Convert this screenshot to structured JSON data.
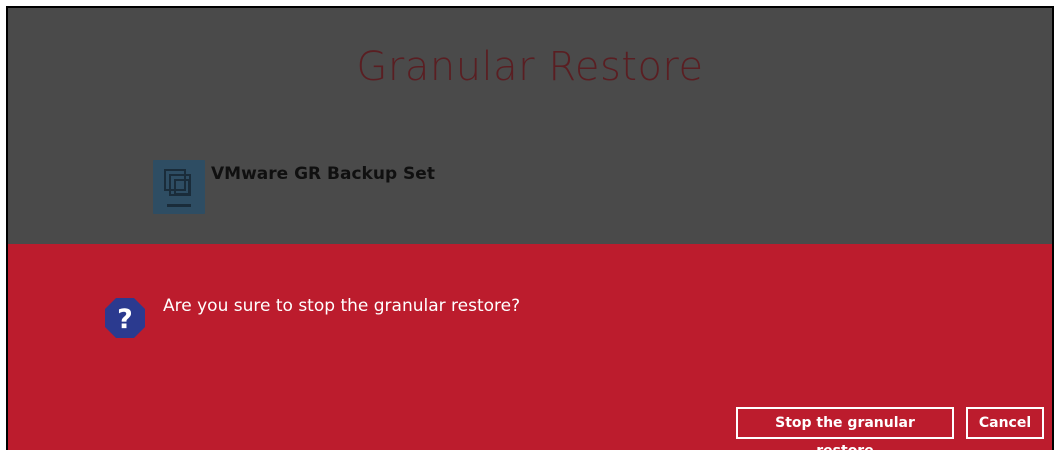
{
  "header": {
    "title": "Granular Restore"
  },
  "backup_set": {
    "name": "VMware GR Backup Set",
    "icon": "vmware-backup-set-icon"
  },
  "dialog": {
    "icon": "question-icon",
    "message": "Are you sure to stop the granular restore?",
    "confirm_label": "Stop the granular restore",
    "cancel_label": "Cancel"
  },
  "colors": {
    "overlay": "#4a4a4a",
    "dialog_background": "#bc1c2d",
    "title_text": "#5a1e22",
    "question_icon": "#2b3a8f"
  }
}
